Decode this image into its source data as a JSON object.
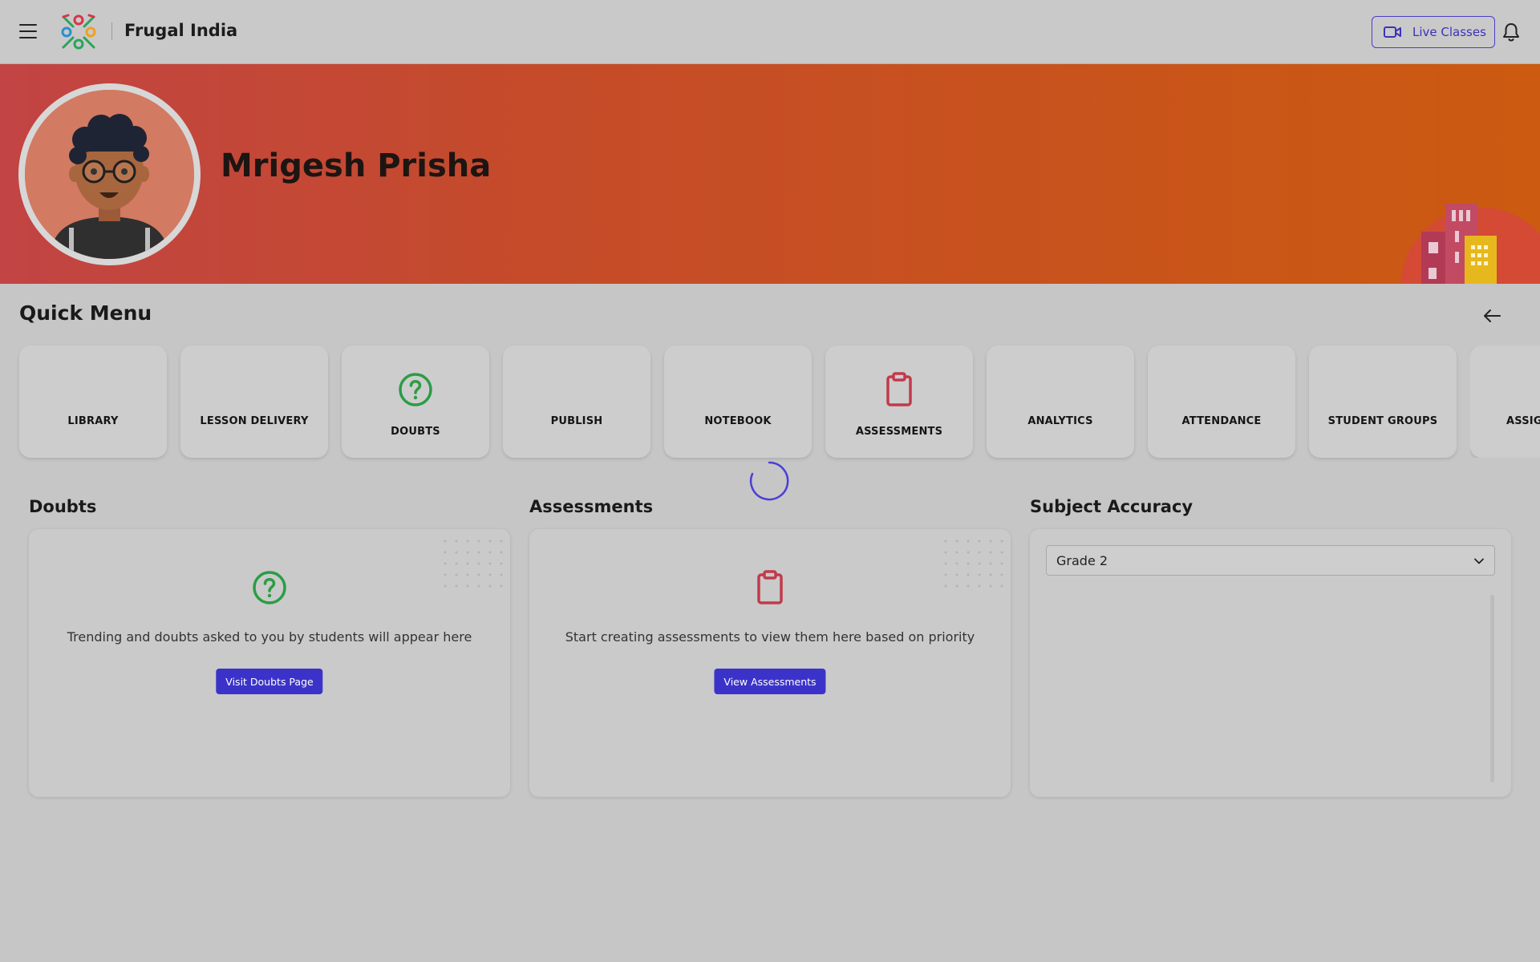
{
  "topbar": {
    "brand": "Frugal India",
    "live_classes_label": "Live Classes"
  },
  "banner": {
    "user_name": "Mrigesh Prisha"
  },
  "quick_menu": {
    "title": "Quick Menu",
    "items": [
      {
        "label": "LIBRARY",
        "icon": ""
      },
      {
        "label": "LESSON DELIVERY",
        "icon": ""
      },
      {
        "label": "DOUBTS",
        "icon": "question-circle-icon"
      },
      {
        "label": "PUBLISH",
        "icon": ""
      },
      {
        "label": "NOTEBOOK",
        "icon": ""
      },
      {
        "label": "ASSESSMENTS",
        "icon": "clipboard-icon"
      },
      {
        "label": "ANALYTICS",
        "icon": ""
      },
      {
        "label": "ATTENDANCE",
        "icon": ""
      },
      {
        "label": "STUDENT GROUPS",
        "icon": ""
      },
      {
        "label": "ASSIGI",
        "icon": ""
      }
    ]
  },
  "doubts": {
    "title": "Doubts",
    "message": "Trending and doubts asked to you by students will appear here",
    "button_label": "Visit Doubts Page"
  },
  "assessments": {
    "title": "Assessments",
    "message": "Start creating assessments to view them here based on priority",
    "button_label": "View Assessments"
  },
  "subject_accuracy": {
    "title": "Subject Accuracy",
    "selected_grade": "Grade 2"
  },
  "colors": {
    "accent": "#3b33c9",
    "doubts_icon": "#2a9d45",
    "assessments_icon": "#c23a4a"
  }
}
